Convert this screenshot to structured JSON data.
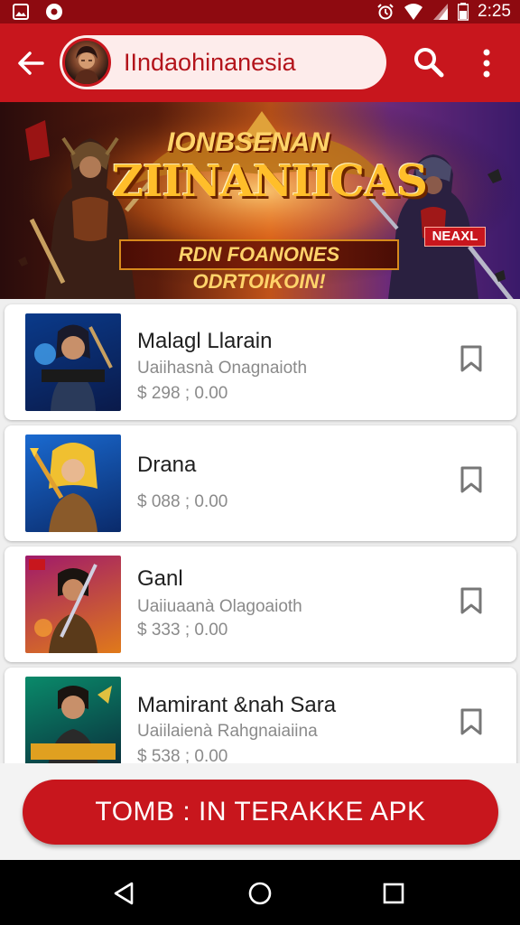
{
  "status": {
    "time": "2:25"
  },
  "app_bar": {
    "title": "IIndaohinanesia"
  },
  "banner": {
    "top_text": "IONBSENAN",
    "title": "ZIINANIICAS",
    "tagline": "RDN FOANONES ODRTOIKOIN!",
    "badge": "NEAXL"
  },
  "items": [
    {
      "title": "Malagl Llarain",
      "subtitle": "Uaiihasnà Onagnaioth",
      "price": "$ 298 ; 0.00"
    },
    {
      "title": "Drana",
      "subtitle": "",
      "price": "$ 088 ; 0.00"
    },
    {
      "title": "Ganl",
      "subtitle": "Uaiiuaanà Olagoaioth",
      "price": "$ 333 ; 0.00"
    },
    {
      "title": "Mamirant &nah Sara",
      "subtitle": "Uaiilaienà Rahgnaiaiina",
      "price": "$ 538 ; 0.00"
    }
  ],
  "install_button": "TOMB : IN TERAKKE APK",
  "colors": {
    "primary": "#c8161d",
    "status_bar": "#8e0a10",
    "pill": "#fdeceb"
  },
  "icons": [
    "back-arrow-icon",
    "search-icon",
    "more-vert-icon",
    "bookmark-icon",
    "nav-back-icon",
    "nav-home-icon",
    "nav-recents-icon"
  ]
}
